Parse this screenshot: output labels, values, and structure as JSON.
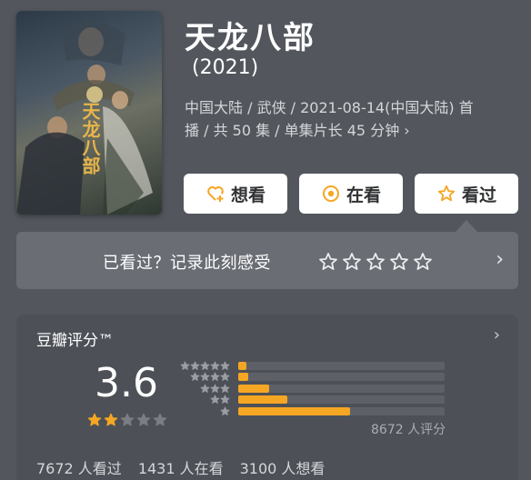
{
  "movie": {
    "title": "天龙八部",
    "year": "(2021)",
    "meta_line1": "中国大陆 / 武侠 / 2021-08-14(中国大陆) 首",
    "meta_line2": "播 / 共 50 集 / 单集片长 45 分钟",
    "meta_chevron": "›",
    "poster_text": "天龙八部"
  },
  "actions": {
    "want_label": "想看",
    "watching_label": "在看",
    "watched_label": "看过"
  },
  "record": {
    "prompt": "已看过？记录此刻感受",
    "stars_count": 5,
    "chevron": "›"
  },
  "rating": {
    "header": "豆瓣评分™",
    "header_chevron": "›",
    "score": "3.6",
    "stars_filled": 2,
    "stars_total": 5,
    "distribution": [
      {
        "stars": 5,
        "fraction": 0.04
      },
      {
        "stars": 4,
        "fraction": 0.05
      },
      {
        "stars": 3,
        "fraction": 0.15
      },
      {
        "stars": 2,
        "fraction": 0.24
      },
      {
        "stars": 1,
        "fraction": 0.54
      }
    ],
    "total_ratings": "8672 人评分",
    "watched_count": "7672 人看过",
    "watching_count": "1431 人在看",
    "want_count": "3100 人想看"
  },
  "colors": {
    "accent": "#f5a623",
    "background": "#53575d",
    "card": "#6a6e74",
    "panel": "#4d5157"
  },
  "icons": {
    "want": "heart-plus-icon",
    "watching": "target-circle-icon",
    "watched": "star-outline-icon"
  }
}
